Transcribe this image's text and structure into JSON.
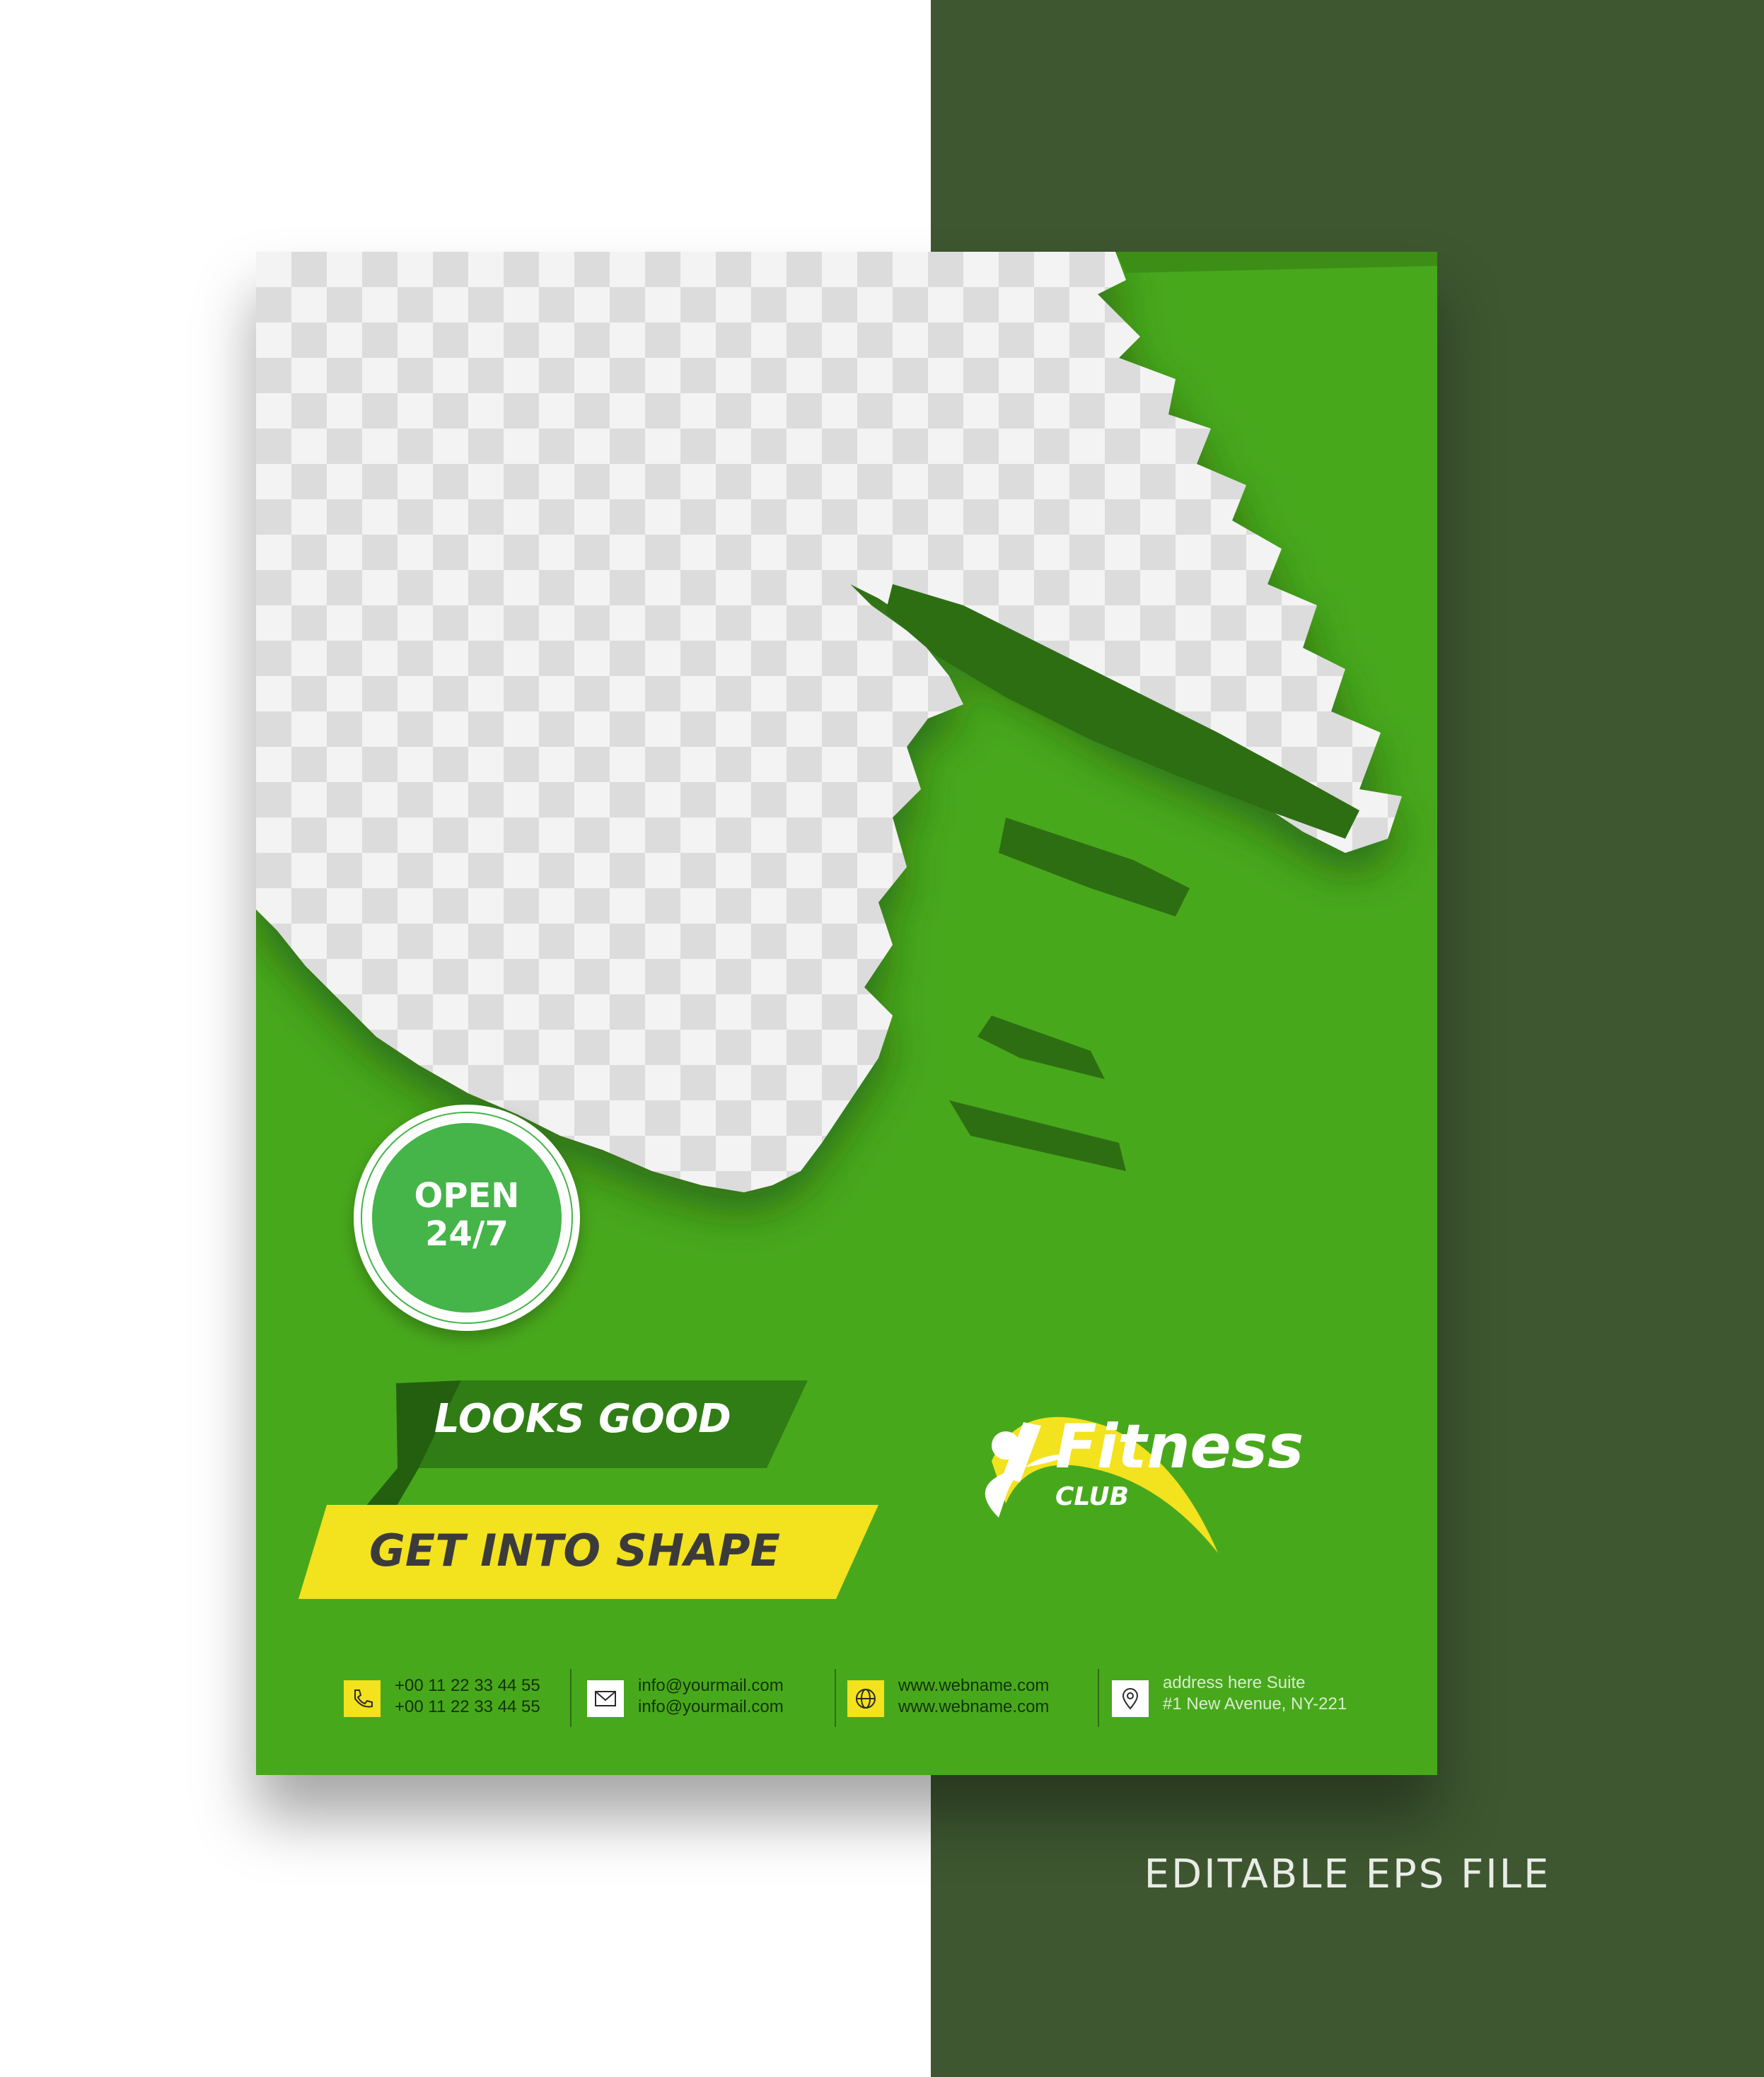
{
  "badge": {
    "line1": "OPEN",
    "line2": "24/7"
  },
  "taglines": {
    "top": "LOOKS GOOD",
    "bottom": "GET INTO SHAPE"
  },
  "logo": {
    "name": "Fitness",
    "sub": "CLUB"
  },
  "contacts": {
    "phone": {
      "icon": "phone-icon",
      "line1": "+00 11 22 33 44 55",
      "line2": "+00 11 22 33 44 55"
    },
    "email": {
      "icon": "mail-icon",
      "line1": "info@yourmail.com",
      "line2": "info@yourmail.com"
    },
    "web": {
      "icon": "globe-icon",
      "line1": "www.webname.com",
      "line2": "www.webname.com"
    },
    "address": {
      "icon": "location-pin-icon",
      "line1": "address here Suite",
      "line2": "#1 New Avenue, NY-221"
    }
  },
  "caption": "EDITABLE EPS FILE",
  "colors": {
    "flyer_green": "#48a81c",
    "panel_green": "#3e5730",
    "accent_yellow": "#f5e21c"
  }
}
